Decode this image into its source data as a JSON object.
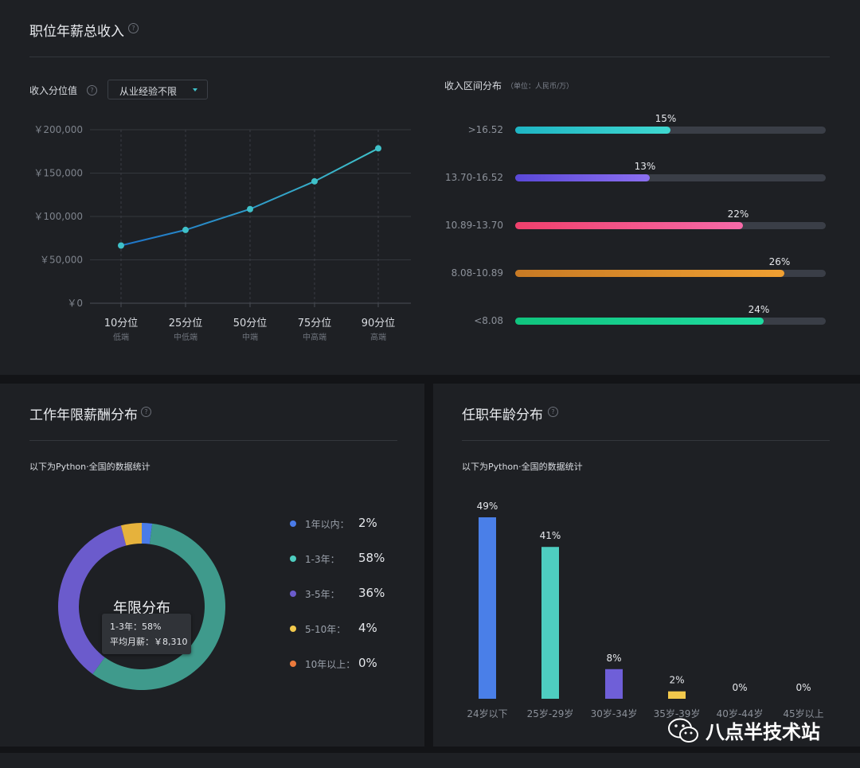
{
  "top_panel": {
    "title": "职位年薪总收入",
    "left": {
      "label": "收入分位值",
      "dropdown_value": "从业经验不限"
    },
    "right": {
      "label": "收入区间分布",
      "unit": "（单位：人民币/万）"
    }
  },
  "bl_panel": {
    "title": "工作年限薪酬分布",
    "subtitle": "以下为Python·全国的数据统计",
    "donut_center": "年限分布",
    "tooltip": {
      "line1": "1-3年：58%",
      "line2": "平均月薪：￥8,310"
    },
    "legend": [
      {
        "label": "1年以内：",
        "value": "2%"
      },
      {
        "label": "1-3年：",
        "value": "58%"
      },
      {
        "label": "3-5年：",
        "value": "36%"
      },
      {
        "label": "5-10年：",
        "value": "4%"
      },
      {
        "label": "10年以上：",
        "value": "0%"
      }
    ]
  },
  "br_panel": {
    "title": "任职年龄分布",
    "subtitle": "以下为Python·全国的数据统计"
  },
  "watermark": {
    "text": "八点半技术站",
    "icon": "wechat-icon"
  },
  "colors": {
    "accent": "#3fc1c9",
    "track": "#3a3e47"
  },
  "chart_data": [
    {
      "type": "line",
      "categories": [
        "10分位",
        "25分位",
        "50分位",
        "75分位",
        "90分位"
      ],
      "sublabels": [
        "低端",
        "中低端",
        "中端",
        "中高端",
        "高端"
      ],
      "values": [
        66500,
        84500,
        108500,
        140500,
        178500
      ],
      "ylim": [
        0,
        200000
      ],
      "yticks": [
        0,
        50000,
        100000,
        150000,
        200000
      ],
      "ytick_labels": [
        "￥0",
        "￥50,000",
        "￥100,000",
        "￥150,000",
        "￥200,000"
      ],
      "grid": true
    },
    {
      "type": "bar",
      "orientation": "horizontal",
      "categories": [
        ">16.52",
        "13.70-16.52",
        "10.89-13.70",
        "8.08-10.89",
        "<8.08"
      ],
      "values": [
        15,
        13,
        22,
        26,
        24
      ],
      "value_labels": [
        "15%",
        "13%",
        "22%",
        "26%",
        "24%"
      ],
      "xlim": [
        0,
        30
      ],
      "colors": [
        [
          "#1fb5c4",
          "#3fd8d0"
        ],
        [
          "#5a48d8",
          "#8b6ff0"
        ],
        [
          "#f0406c",
          "#f76aa8"
        ],
        [
          "#c87a24",
          "#f0a032"
        ],
        [
          "#10c47e",
          "#1fdba0"
        ]
      ]
    },
    {
      "type": "pie",
      "categories": [
        "1年以内",
        "1-3年",
        "3-5年",
        "5-10年",
        "10年以上"
      ],
      "values": [
        2,
        58,
        36,
        4,
        0
      ],
      "colors": [
        "#4a7be8",
        "#3f9a8c",
        "#6b5bcc",
        "#e6b23c",
        "#ec7a3c"
      ]
    },
    {
      "type": "bar",
      "categories": [
        "24岁以下",
        "25岁-29岁",
        "30岁-34岁",
        "35岁-39岁",
        "40岁-44岁",
        "45岁以上"
      ],
      "values": [
        49,
        41,
        8,
        2,
        0,
        0
      ],
      "value_labels": [
        "49%",
        "41%",
        "8%",
        "2%",
        "0%",
        "0%"
      ],
      "ylim": [
        0,
        55
      ],
      "colors": [
        "#4a7fe8",
        "#4ecdc0",
        "#6f5fd8",
        "#f2c94c",
        "#888888",
        "#888888"
      ]
    }
  ]
}
